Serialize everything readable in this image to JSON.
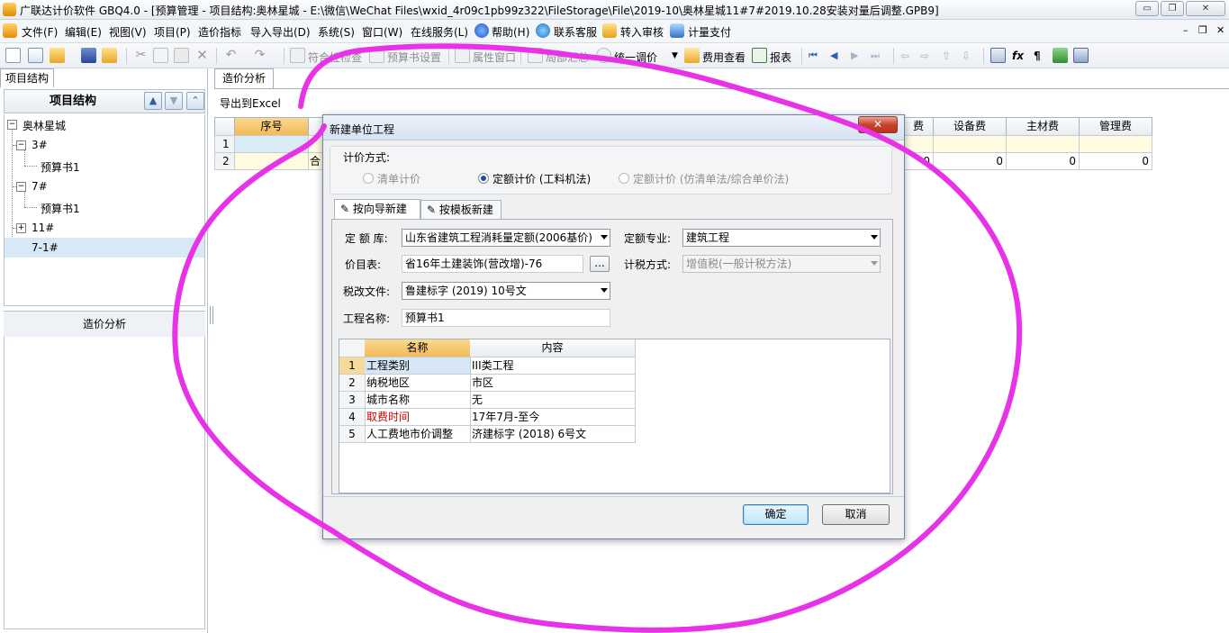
{
  "window": {
    "title": "广联达计价软件 GBQ4.0 - [预算管理 - 项目结构:奥林星城 - E:\\微信\\WeChat Files\\wxid_4r09c1pb99z322\\FileStorage\\File\\2019-10\\奥林星城11#7#2019.10.28安装对量后调整.GPB9]",
    "min_glyph": "▭",
    "max_glyph": "❐",
    "close_glyph": "✕",
    "doc_min_glyph": "–",
    "doc_restore_glyph": "❐",
    "doc_close_glyph": "✕"
  },
  "menu": [
    {
      "label": "文件(F)"
    },
    {
      "label": "编辑(E)"
    },
    {
      "label": "视图(V)"
    },
    {
      "label": "项目(P)"
    },
    {
      "label": "造价指标"
    },
    {
      "label": "导入导出(D)"
    },
    {
      "label": "系统(S)"
    },
    {
      "label": "窗口(W)"
    },
    {
      "label": "在线服务(L)"
    },
    {
      "label": "帮助(H)"
    },
    {
      "label": "联系客服"
    },
    {
      "label": "转入审核"
    },
    {
      "label": "计量支付"
    }
  ],
  "toolbar": {
    "labels": [
      "符合性检查",
      "预算书设置",
      "属性窗口",
      "局部汇总",
      "统一调价",
      "费用查看",
      "报表"
    ]
  },
  "left_panel": {
    "tab": "项目结构",
    "title": "项目结构",
    "up_arrow": "▲",
    "down_arrow": "▼",
    "collapse_arrow": "⌃",
    "tree": [
      {
        "label": "奥林星城",
        "expander": "−"
      },
      {
        "label": "3#",
        "expander": "−"
      },
      {
        "label": "预算书1"
      },
      {
        "label": "7#",
        "expander": "−"
      },
      {
        "label": "预算书1"
      },
      {
        "label": "11#",
        "expander": "+"
      },
      {
        "label": "7-1#"
      }
    ],
    "lower_header": "造价分析"
  },
  "right_panel": {
    "tab": "造价分析",
    "export_link": "导出到Excel",
    "columns": [
      "序号",
      "",
      "费",
      "设备费",
      "主材费",
      "管理费"
    ],
    "rows": [
      {
        "num": "1",
        "name": "",
        "vals": [
          "",
          "",
          "",
          ""
        ]
      },
      {
        "num": "2",
        "name": "合",
        "vals": [
          "0",
          "0",
          "0",
          "0"
        ]
      }
    ]
  },
  "dialog": {
    "title": "新建单位工程",
    "close": "✕",
    "pricing_group_label": "计价方式:",
    "pricing_options": [
      {
        "label": "清单计价",
        "selected": false,
        "enabled": false
      },
      {
        "label": "定额计价 (工料机法)",
        "selected": true,
        "enabled": true
      },
      {
        "label": "定额计价 (仿清单法/综合单价法)",
        "selected": false,
        "enabled": false
      }
    ],
    "tabs": [
      {
        "label": "按向导新建",
        "icon": "✎"
      },
      {
        "label": "按模板新建",
        "icon": "✎"
      }
    ],
    "fields": {
      "quota_lib_label": "定 额 库:",
      "quota_lib_value": "山东省建筑工程消耗量定额(2006基价)",
      "specialty_label": "定额专业:",
      "specialty_value": "建筑工程",
      "price_table_label": "价目表:",
      "price_table_value": "省16年土建装饰(营改增)-76",
      "ellipsis": "...",
      "tax_method_label": "计税方式:",
      "tax_method_value": "增值税(一般计税方法)",
      "tax_reform_label": "税改文件:",
      "tax_reform_value": "鲁建标字 (2019) 10号文",
      "project_name_label": "工程名称:",
      "project_name_value": "预算书1"
    },
    "info_table": {
      "headers": [
        "名称",
        "内容"
      ],
      "rows": [
        {
          "num": "1",
          "name": "工程类别",
          "value": "III类工程",
          "name_color": "#000000"
        },
        {
          "num": "2",
          "name": "纳税地区",
          "value": "市区",
          "name_color": "#000000"
        },
        {
          "num": "3",
          "name": "城市名称",
          "value": "无",
          "name_color": "#000000"
        },
        {
          "num": "4",
          "name": "取费时间",
          "value": "17年7月-至今",
          "name_color": "#d40000"
        },
        {
          "num": "5",
          "name": "人工费地市价调整",
          "value": "济建标字 (2018) 6号文",
          "name_color": "#000000"
        }
      ]
    },
    "ok": "确定",
    "cancel": "取消"
  },
  "colors": {
    "annotation_stroke": "#e832e8",
    "header_orange": "#f7c56f",
    "selected_row": "#d9e8f7"
  }
}
